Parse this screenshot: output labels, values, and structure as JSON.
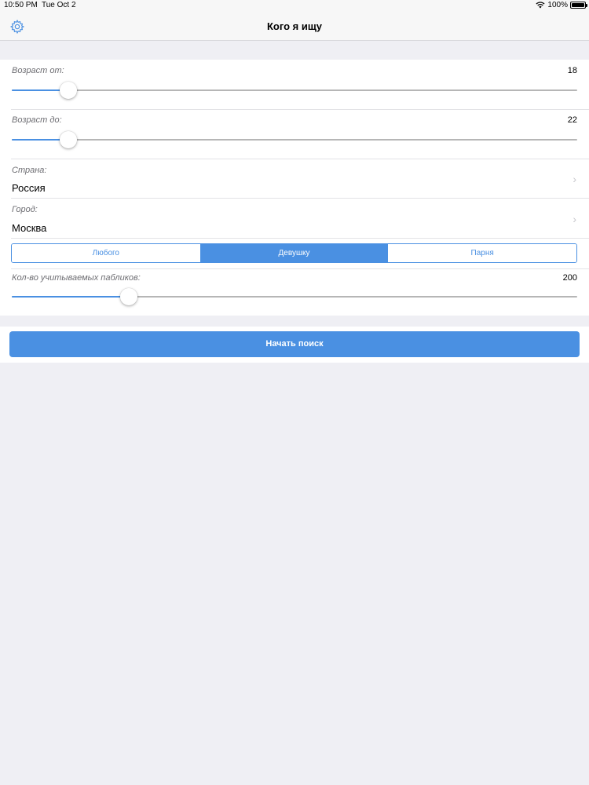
{
  "status_bar": {
    "time": "10:50 PM",
    "date": "Tue Oct 2",
    "battery": "100%",
    "wifi_icon": "wifi-icon",
    "battery_icon": "battery-icon"
  },
  "nav": {
    "title": "Кого я ищу",
    "settings_icon": "gear-icon"
  },
  "form": {
    "age_from": {
      "label": "Возраст от:",
      "value": "18",
      "slider_fraction": 0.1
    },
    "age_to": {
      "label": "Возраст до:",
      "value": "22",
      "slider_fraction": 0.1
    },
    "country": {
      "label": "Страна:",
      "value": "Россия"
    },
    "city": {
      "label": "Город:",
      "value": "Москва"
    },
    "gender": {
      "options": [
        "Любого",
        "Девушку",
        "Парня"
      ],
      "selected": "Девушку"
    },
    "publics_count": {
      "label": "Кол-во учитываемых пабликов:",
      "value": "200",
      "slider_fraction": 0.207
    }
  },
  "actions": {
    "start_label": "Начать поиск"
  },
  "colors": {
    "accent": "#4a90e2",
    "background": "#efeff4"
  }
}
